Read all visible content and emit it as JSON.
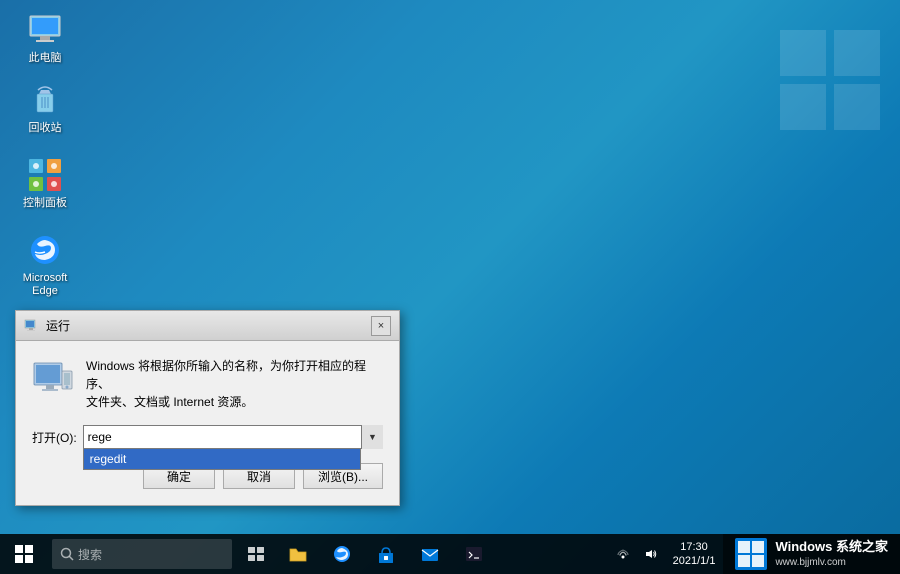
{
  "desktop": {
    "background_color_start": "#1a6fa8",
    "background_color_end": "#0a6a9e"
  },
  "icons": [
    {
      "id": "thispc",
      "label": "此电脑",
      "type": "computer"
    },
    {
      "id": "recycle",
      "label": "回收站",
      "type": "recycle"
    },
    {
      "id": "controlpanel",
      "label": "控制面板",
      "type": "controlpanel"
    },
    {
      "id": "edge",
      "label": "Microsoft\nEdge",
      "type": "edge"
    }
  ],
  "run_dialog": {
    "title": "运行",
    "close_label": "×",
    "description": "Windows 将根据你所输入的名称，为你打开相应的程序、\n文件夹、文档或 Internet 资源。",
    "input_label": "打开(O):",
    "input_value": "rege",
    "autocomplete_item": "regedit",
    "btn_ok": "确定",
    "btn_cancel": "取消",
    "btn_browse": "浏览(B)..."
  },
  "taskbar": {
    "search_placeholder": "搜索",
    "time": "17:30",
    "date": "2021/1/1"
  },
  "watermark": {
    "text1": "Windows 系统之家",
    "text2": "www.bjjmlv.com"
  }
}
